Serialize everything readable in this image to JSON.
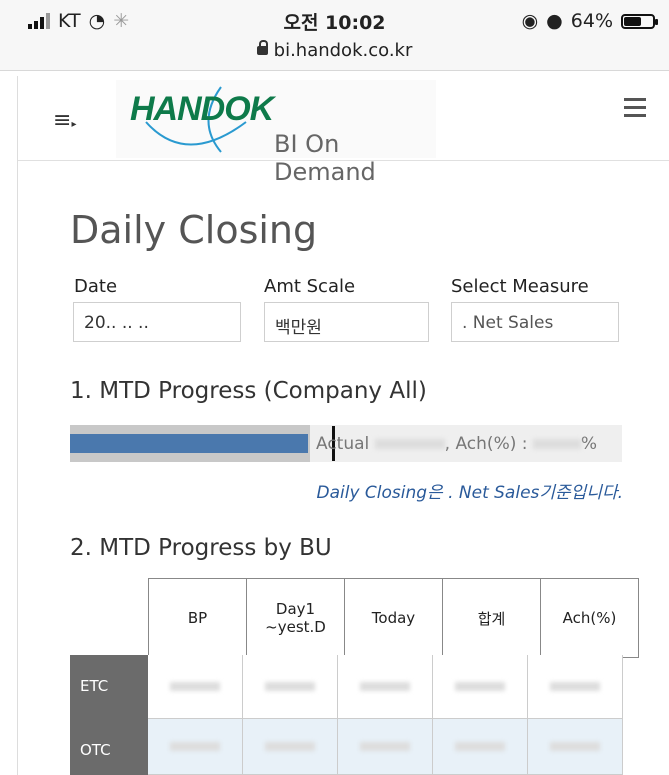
{
  "status_bar": {
    "carrier": "KT",
    "time": "오전 10:02",
    "battery": "64%",
    "battery_level": 0.64,
    "url": "bi.handok.co.kr"
  },
  "header": {
    "logo_text": "HANDOK",
    "subtitle": "BI On Demand",
    "brand_color": "#0e7a4a"
  },
  "page": {
    "title": "Daily Closing"
  },
  "filters": {
    "date_label": "Date",
    "date_value": "20..  .. ..",
    "amt_label": "Amt Scale",
    "amt_value": "백만원",
    "measure_label": "Select Measure",
    "measure_value": ". Net Sales"
  },
  "mtd": {
    "section_title": "1. MTD Progress (Company All)",
    "actual_label": "Actual",
    "ach_label": ", Ach(%) :",
    "percent_sign": "%",
    "bar_color": "#4a78ad",
    "note": "Daily Closing은 . Net Sales기준입니다."
  },
  "bu": {
    "section_title": "2. MTD Progress by BU",
    "columns": [
      "BP",
      "Day1\n~yest.D",
      "Today",
      "합계",
      "Ach(%)"
    ],
    "rows": [
      {
        "label": "ETC"
      },
      {
        "label": "OTC"
      }
    ]
  }
}
